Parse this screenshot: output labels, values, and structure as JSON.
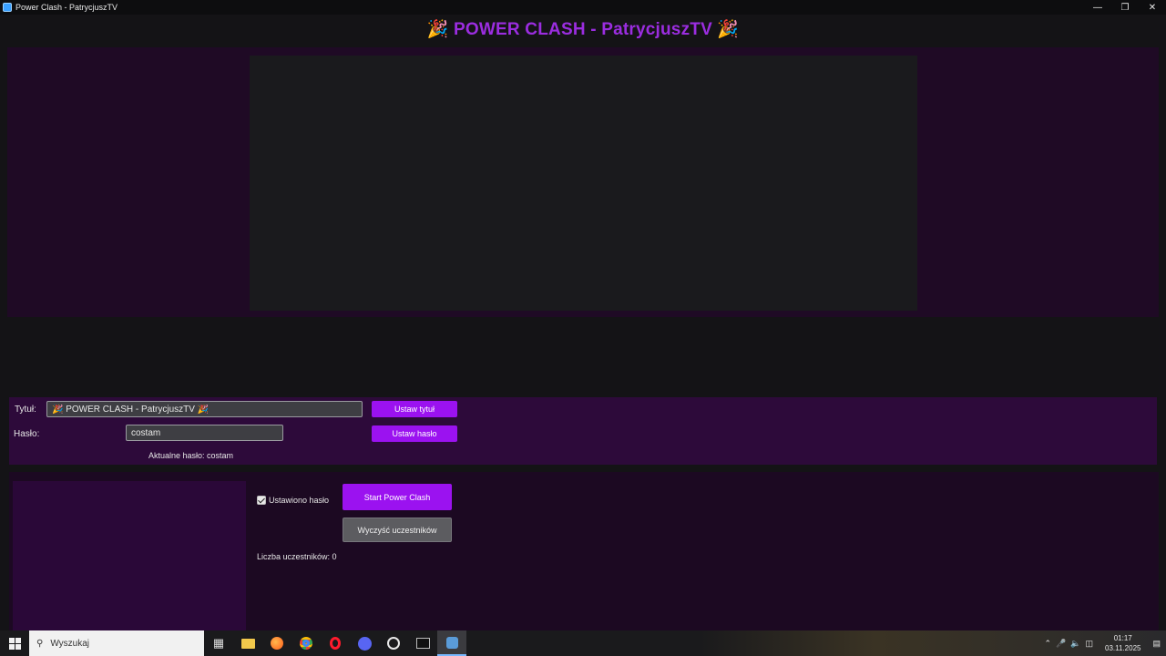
{
  "window": {
    "title": "Power Clash - PatrycjuszTV",
    "controls": [
      "minimize",
      "restore",
      "close"
    ]
  },
  "header": {
    "title": "🎉 POWER CLASH - PatrycjuszTV 🎉"
  },
  "settings": {
    "title_label": "Tytuł:",
    "title_value": "🎉 POWER CLASH - PatrycjuszTV 🎉",
    "set_title_button": "Ustaw tytuł",
    "password_label": "Hasło:",
    "password_value": "costam",
    "set_password_button": "Ustaw hasło",
    "current_password_text": "Aktualne hasło: costam"
  },
  "controls": {
    "password_set_checkbox_label": "Ustawiono hasło",
    "password_set_checked": true,
    "start_button": "Start Power Clash",
    "clear_button": "Wyczyść uczestników",
    "participants_count_text": "Liczba uczestników: 0"
  },
  "taskbar": {
    "search_placeholder": "Wyszukaj",
    "apps": [
      "task-view",
      "file-explorer",
      "firefox",
      "chrome",
      "opera",
      "discord",
      "clock-app",
      "terminal",
      "power-clash-app"
    ],
    "time": "01:17",
    "date": "03.11.2025"
  },
  "colors": {
    "accent": "#9b12f0",
    "header_text": "#9b2de0",
    "panel_bg": "#2d0a3a"
  }
}
